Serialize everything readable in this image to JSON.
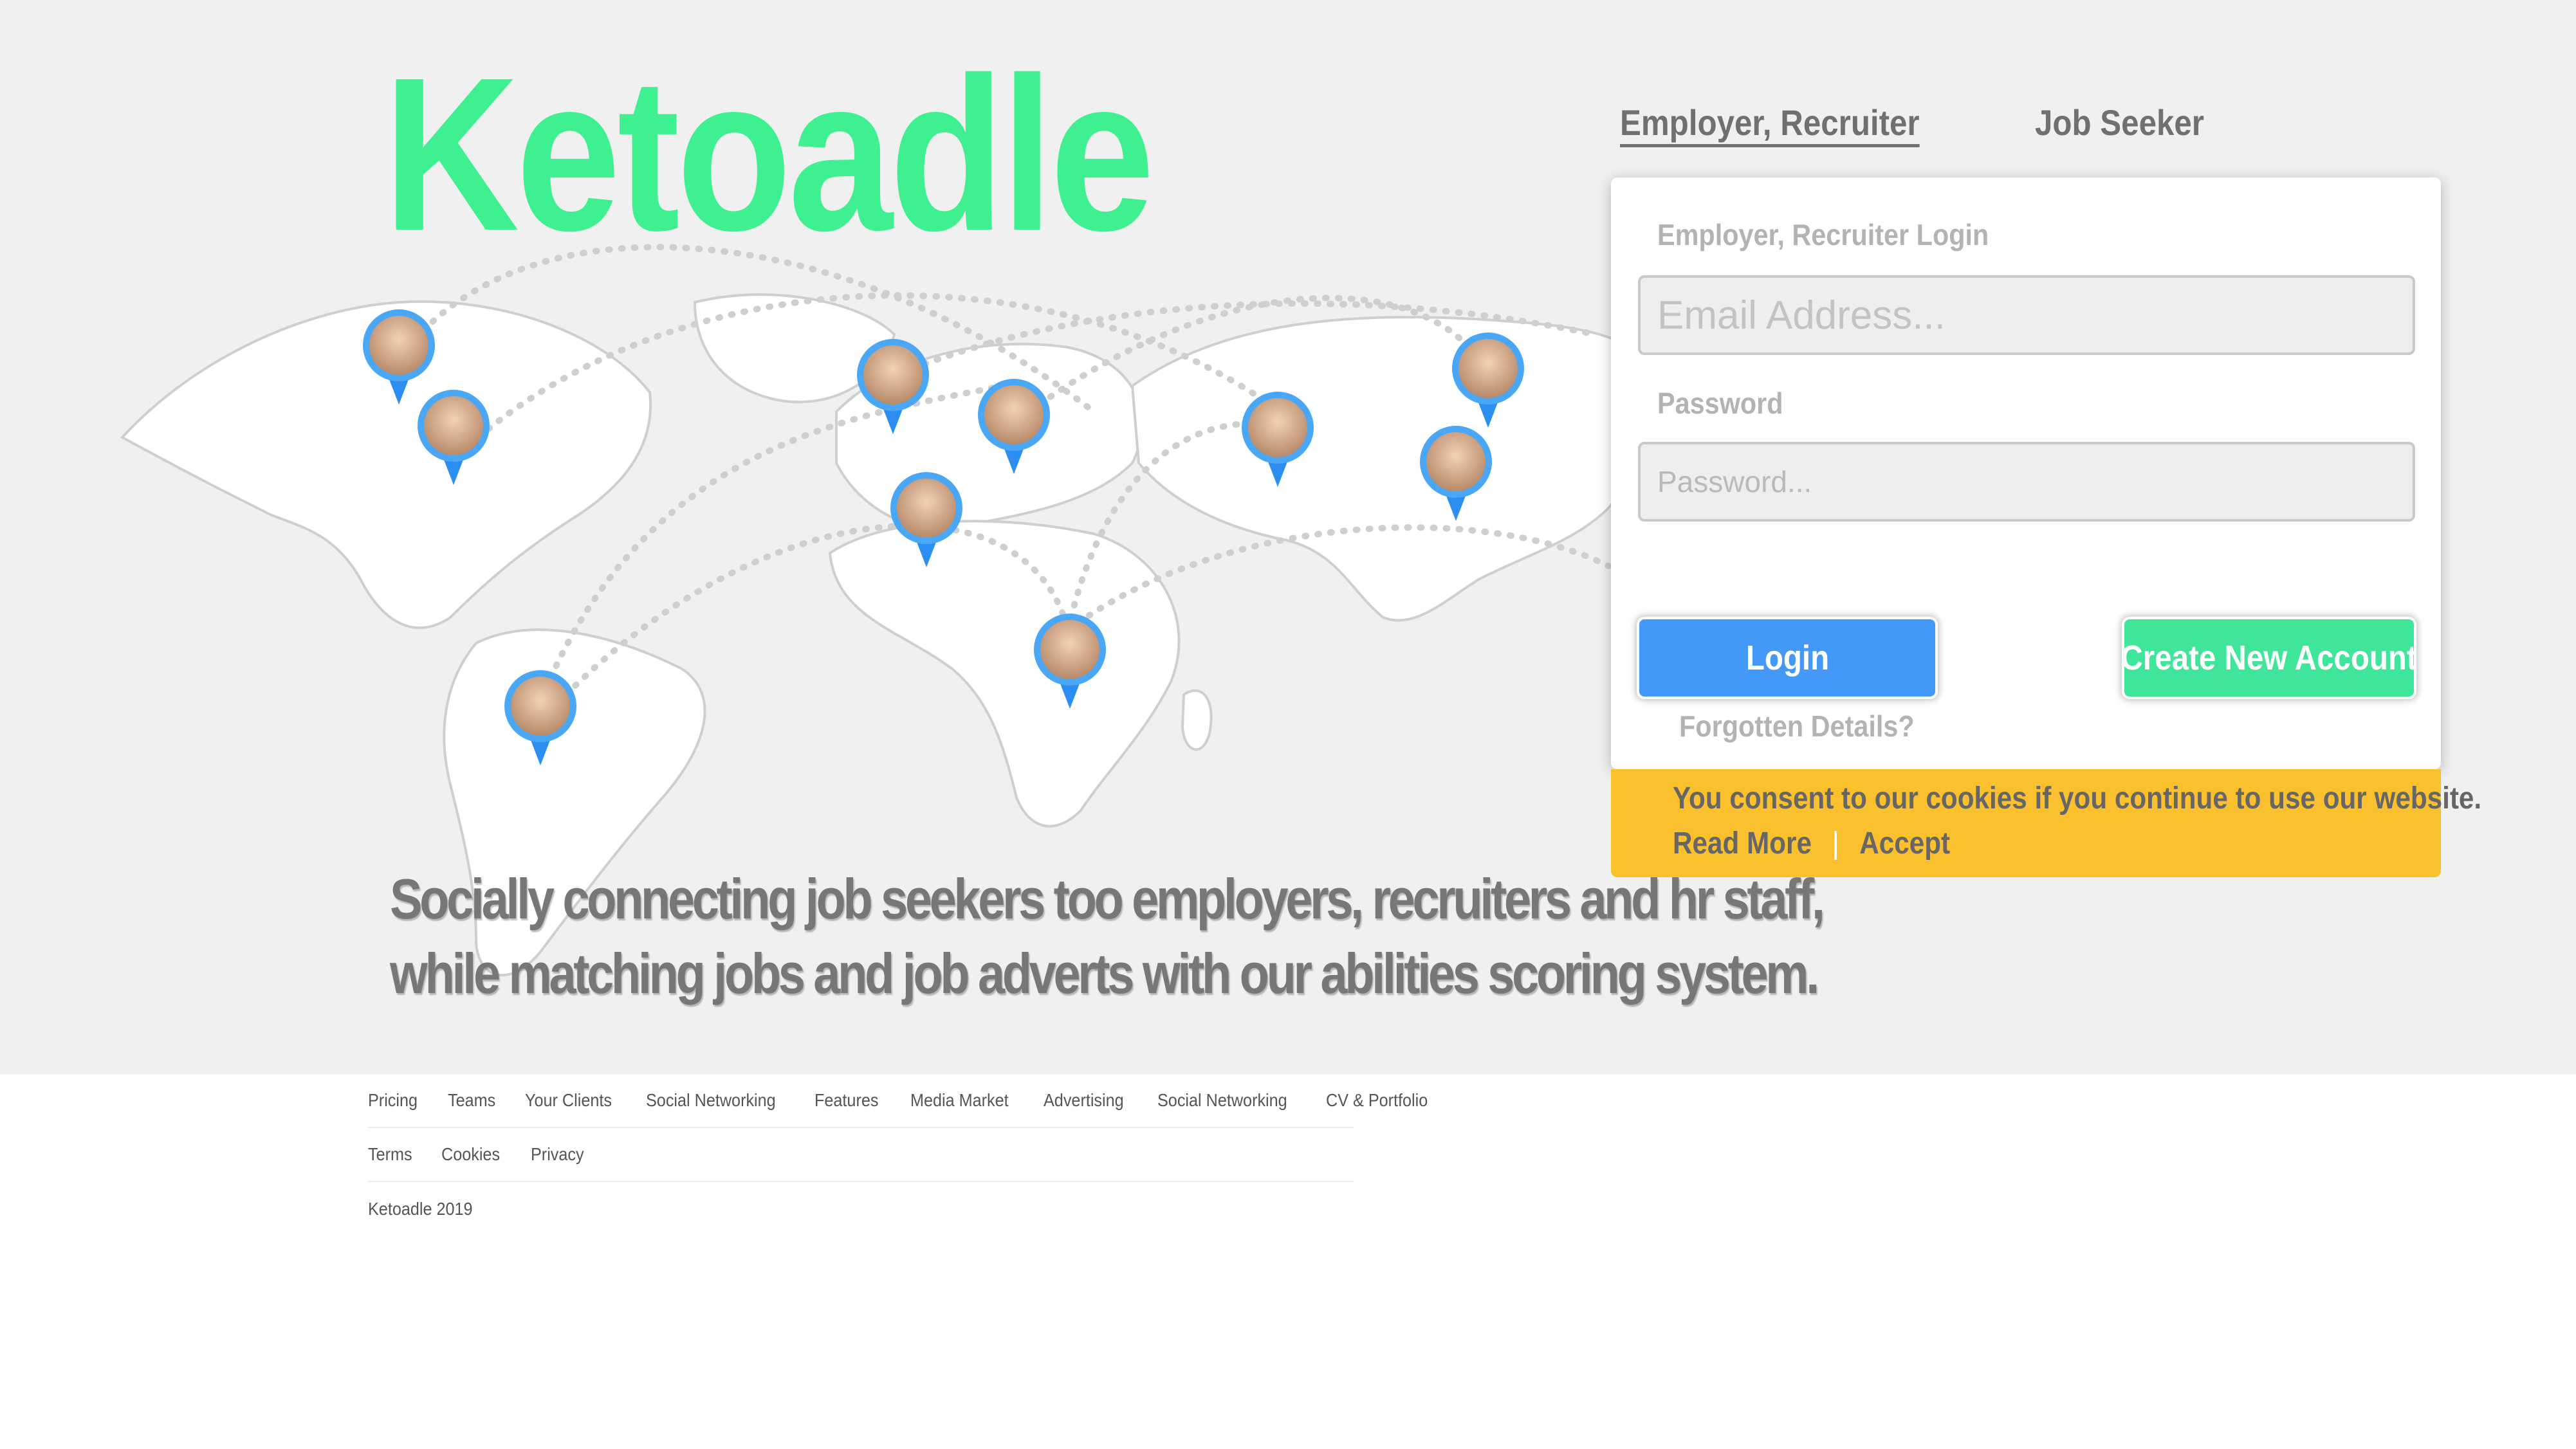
{
  "brand": {
    "logo_text": "Ketoadle",
    "accent": "#3ff090"
  },
  "hero": {
    "tagline_line1": "Socially connecting job seekers too employers, recruiters and hr staff,",
    "tagline_line2": "while matching jobs and job adverts with our abilities scoring system."
  },
  "auth": {
    "tabs": [
      {
        "label": "Employer, Recruiter",
        "active": true
      },
      {
        "label": "Job Seeker",
        "active": false
      }
    ],
    "panel_title": "Employer, Recruiter Login",
    "email_placeholder": "Email Address...",
    "password_label": "Password",
    "password_placeholder": "Password...",
    "login_label": "Login",
    "create_label": "Create New Account",
    "forgot_label": "Forgotten Details?",
    "colors": {
      "login": "#4499f8",
      "create": "#3fe69a"
    }
  },
  "cookie": {
    "message": "You consent to our cookies if you continue to use our website.",
    "read_more": "Read More",
    "separator": "|",
    "accept": "Accept",
    "color": "#fbc02d"
  },
  "footer": {
    "row1": [
      "Pricing",
      "Teams",
      "Your Clients",
      "Social Networking",
      "Features",
      "Media Market",
      "Advertising",
      "Social Networking",
      "CV & Portfolio"
    ],
    "row2": [
      "Terms",
      "Cookies",
      "Privacy"
    ],
    "copyright": "Ketoadle 2019"
  },
  "map_pins": [
    {
      "name": "avatar-pin-icon"
    },
    {
      "name": "avatar-pin-icon"
    },
    {
      "name": "avatar-pin-icon"
    },
    {
      "name": "avatar-pin-icon"
    },
    {
      "name": "avatar-pin-icon"
    },
    {
      "name": "avatar-pin-icon"
    },
    {
      "name": "avatar-pin-icon"
    },
    {
      "name": "avatar-pin-icon"
    },
    {
      "name": "avatar-pin-icon"
    },
    {
      "name": "avatar-pin-icon"
    }
  ]
}
